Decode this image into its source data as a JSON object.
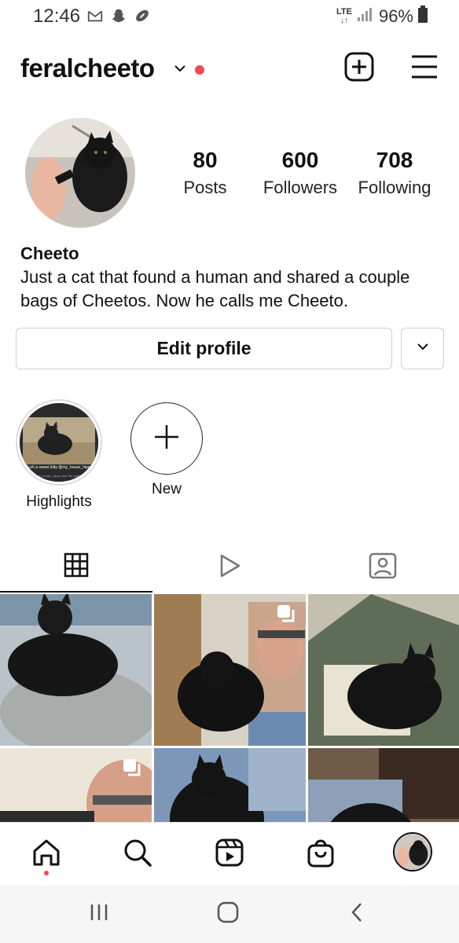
{
  "status_bar": {
    "time": "12:46",
    "network": "LTE",
    "battery": "96%",
    "icons": [
      "gmail-icon",
      "snapchat-icon",
      "football-icon",
      "signal-icon",
      "battery-icon"
    ]
  },
  "header": {
    "username": "feralcheeto",
    "notification_color": "#ed4956"
  },
  "profile": {
    "stats": [
      {
        "value": "80",
        "label": "Posts"
      },
      {
        "value": "600",
        "label": "Followers"
      },
      {
        "value": "708",
        "label": "Following"
      }
    ],
    "name": "Cheeto",
    "bio": "Just a cat that found a human and shared a couple bags of Cheetos. Now he calls me Cheeto."
  },
  "actions": {
    "edit_profile": "Edit profile"
  },
  "highlights": [
    {
      "label": "Highlights",
      "caption_top": "Such a sweet kitty @my_house_hippo",
      "caption_bottom": "@my_house_hippo Just the prettiest"
    },
    {
      "label": "New"
    }
  ],
  "tabs": [
    "grid-icon",
    "reels-icon",
    "tagged-icon"
  ],
  "bottom_nav": [
    "home-icon",
    "search-icon",
    "reels-icon",
    "shop-icon",
    "profile-avatar"
  ],
  "accent_color": "#ed4956"
}
